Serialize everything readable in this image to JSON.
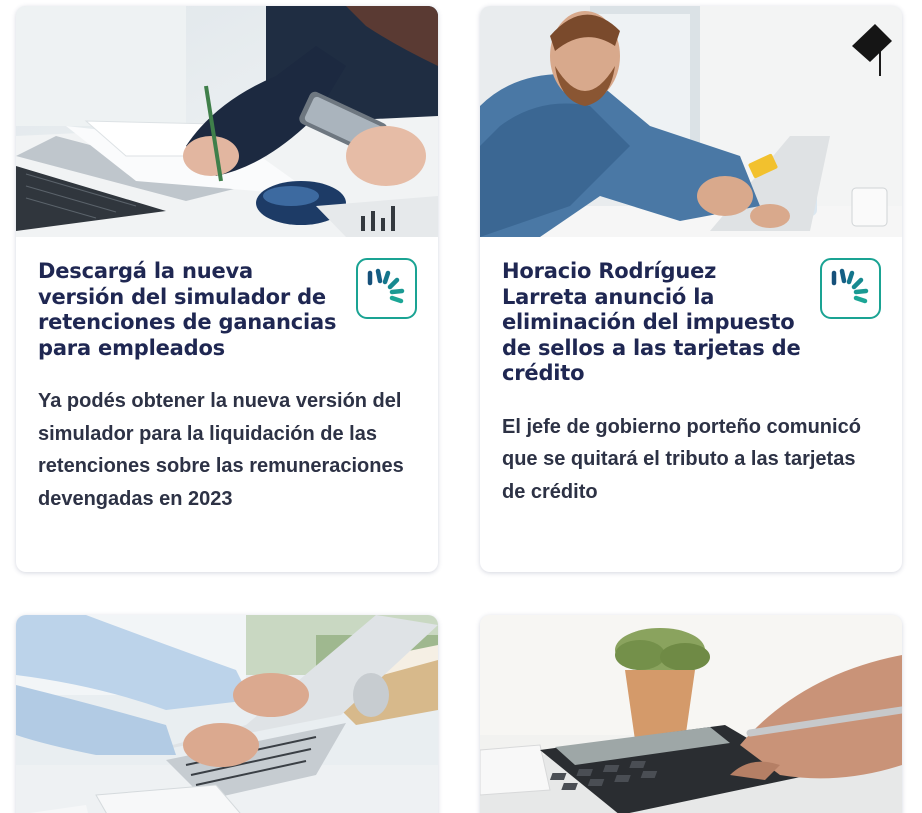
{
  "cards": [
    {
      "image": "photo-hands-writing-with-phone-and-laptop",
      "title": "Descargá la nueva versión del simulador de retenciones de ganancias para empleados",
      "summary": "Ya podés obtener la nueva versión del simulador para la liquidación de las retenciones sobre las remuneraciones devengadas en 2023",
      "badge_icon": "loading-spinner-icon"
    },
    {
      "image": "photo-man-with-credit-card-at-laptop",
      "title": "Horacio Rodríguez Larreta anunció la eliminación del impuesto de sellos a las tarjetas de crédito",
      "summary": "El jefe de gobierno porteño comunicó que se quitará el tributo a las tarjetas de crédito",
      "badge_icon": "loading-spinner-icon"
    },
    {
      "image": "photo-hands-typing-on-laptop"
    },
    {
      "image": "photo-hand-using-calculator"
    }
  ],
  "colors": {
    "title": "#1f2752",
    "summary": "#2d3245",
    "badge_accent": "#1aa393"
  }
}
